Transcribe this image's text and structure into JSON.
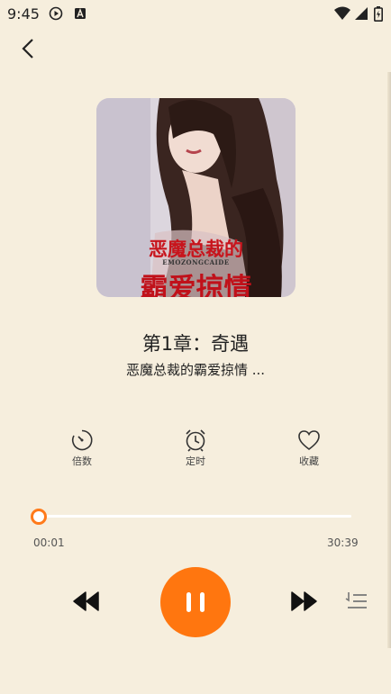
{
  "status": {
    "time": "9:45"
  },
  "cover": {
    "title_line1": "恶魔总裁的",
    "subtitle": "EMOZONGCAIDE",
    "title_line2": "霸爱掠情"
  },
  "track": {
    "chapter_title": "第1章：奇遇",
    "book_title": "恶魔总裁的霸爱掠情 ..."
  },
  "actions": [
    {
      "label": "倍数",
      "icon": "playback-speed-icon"
    },
    {
      "label": "定时",
      "icon": "alarm-clock-icon"
    },
    {
      "label": "收藏",
      "icon": "heart-icon"
    }
  ],
  "progress": {
    "current_time": "00:01",
    "total_time": "30:39",
    "fraction": 0.0005
  },
  "colors": {
    "background": "#f6eedd",
    "accent": "#ff760f"
  }
}
